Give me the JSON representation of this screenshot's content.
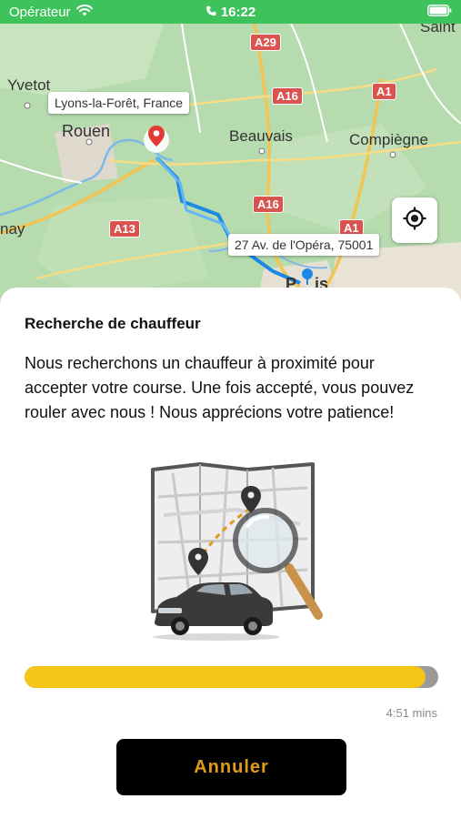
{
  "status_bar": {
    "carrier": "Opérateur",
    "time": "16:22"
  },
  "map": {
    "cities": [
      "Yvetot",
      "Rouen",
      "Beauvais",
      "Compiègne",
      "nay",
      "Saint",
      "P",
      "is"
    ],
    "road_signs": [
      "A29",
      "A16",
      "A1",
      "A16",
      "A13",
      "A1"
    ],
    "origin_label": "Lyons-la-Forêt, France",
    "destination_label": "27 Av. de l'Opéra, 75001",
    "locate_icon": "crosshair-icon"
  },
  "sheet": {
    "title": "Recherche de chauffeur",
    "message": "Nous recherchons un chauffeur à proximité pour accepter votre course. Une fois accepté, vous pouvez rouler avec nous ! Nous apprécions votre patience!",
    "illustration_icon": "map-search-car-illustration",
    "progress_fraction": 0.97,
    "timer": "4:51 mins",
    "cancel_label": "Annuler"
  },
  "colors": {
    "status_green": "#3ec25b",
    "progress_yellow": "#f5c518",
    "button_text": "#e29a1c"
  }
}
